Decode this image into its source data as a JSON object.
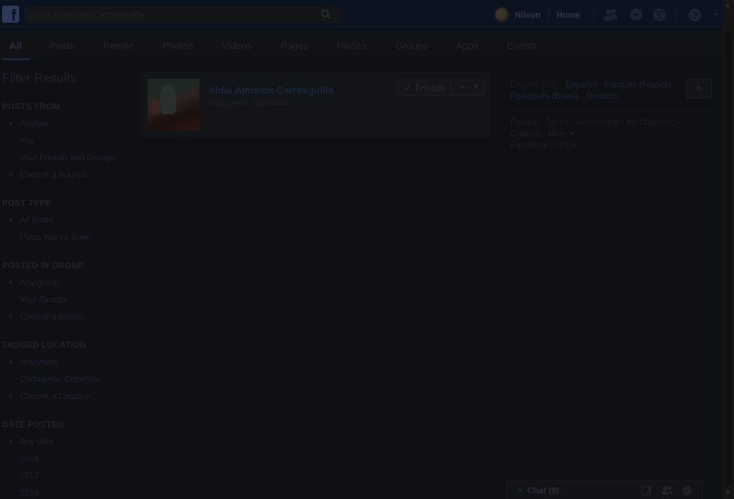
{
  "header": {
    "search_value": "Aldis Almeida Carrasquilla",
    "profile_name": "Nilson",
    "home_label": "Home"
  },
  "tabs": [
    "All",
    "Posts",
    "People",
    "Photos",
    "Videos",
    "Pages",
    "Places",
    "Groups",
    "Apps",
    "Events"
  ],
  "filters": {
    "title": "Filter Results",
    "posts_from": {
      "heading": "POSTS FROM",
      "items": [
        "Anyone",
        "You",
        "Your Friends and Groups"
      ],
      "add": "Choose a Source..."
    },
    "post_type": {
      "heading": "POST TYPE",
      "items": [
        "All Posts",
        "Posts You've Seen"
      ]
    },
    "posted_in_group": {
      "heading": "POSTED IN GROUP",
      "items": [
        "Any group",
        "Your Groups"
      ],
      "add": "Choose a Group..."
    },
    "tagged_location": {
      "heading": "TAGGED LOCATION",
      "items": [
        "Anywhere",
        "Cartagena, Colombia"
      ],
      "add": "Choose a Location..."
    },
    "date_posted": {
      "heading": "DATE POSTED",
      "items": [
        "Any date",
        "2018",
        "2017",
        "2016"
      ]
    }
  },
  "result": {
    "name": "Aldis Almeida Carrasquilla",
    "location": "Cartagena, Colombia",
    "friends_label": "Friends",
    "more_label": "···"
  },
  "languages": {
    "current": "English (US)",
    "others": [
      "Español",
      "Français (France)",
      "Português (Brasil)",
      "Deutsch"
    ],
    "add_label": "+"
  },
  "footer": {
    "links": [
      "Privacy",
      "Terms",
      "Advertising",
      "Ad Choices",
      "Cookies",
      "More"
    ],
    "ad_choices_icon": "▷",
    "more_suffix": "▾",
    "copyright": "Facebook © 2018",
    "separator": "·"
  },
  "chat": {
    "label": "Chat (8)"
  },
  "colors": {
    "header_bg": "#0b1220",
    "page_bg": "#0f1014",
    "card_bg": "#131417"
  }
}
